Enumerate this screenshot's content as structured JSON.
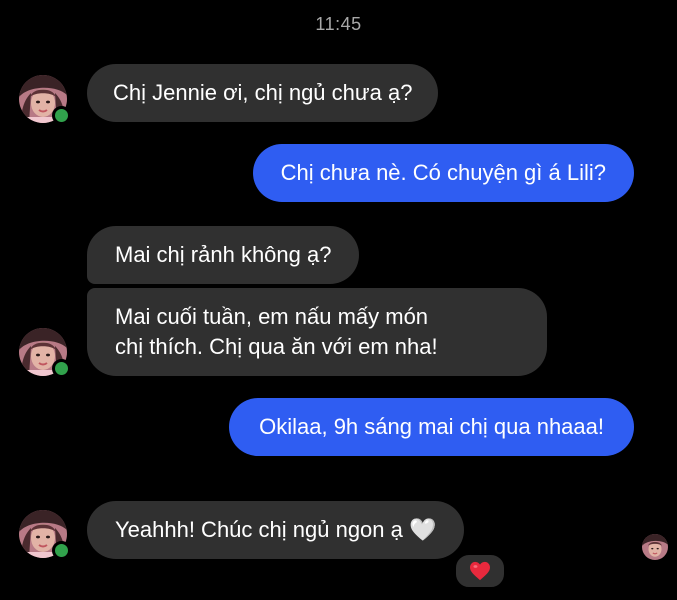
{
  "header": {
    "time": "11:45"
  },
  "messages": [
    {
      "sender": "them",
      "text": "Chị Jennie ơi, chị ngủ chưa ạ?"
    },
    {
      "sender": "me",
      "text": "Chị chưa nè. Có chuyện gì á Lili?"
    },
    {
      "sender": "them",
      "text": "Mai chị rảnh không ạ?"
    },
    {
      "sender": "them",
      "lines": [
        "Mai cuối tuần, em nấu mấy món",
        "chị thích. Chị qua ăn với em nha!"
      ]
    },
    {
      "sender": "me",
      "text": "Okilaa, 9h sáng mai chị qua nhaaa!"
    },
    {
      "sender": "them",
      "text": "Yeahhh! Chúc chị ngủ ngon ạ 🤍",
      "reaction": "red-heart-icon"
    }
  ],
  "colors": {
    "background": "#000000",
    "incoming_bubble": "#303030",
    "outgoing_bubble": "#2f5df2",
    "timestamp": "#a8a8a8",
    "online": "#31a24c",
    "reaction_heart": "#e8293d"
  },
  "icons": {
    "contact_avatar": "contact-avatar",
    "online_indicator": "online-status-dot",
    "reaction": "red-heart-icon",
    "read_receipt": "read-receipt-avatar"
  }
}
